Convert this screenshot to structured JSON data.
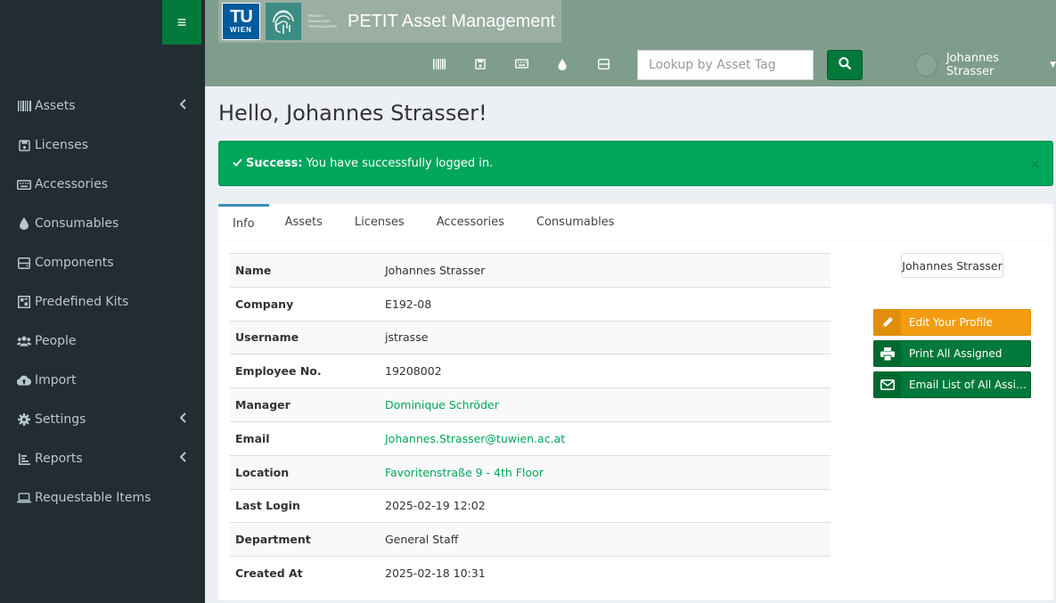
{
  "brand": {
    "tu_top": "TU",
    "tu_bottom": "WIEN",
    "pet_text": "PRIVACY ENHANCING TECHNOLOGIES",
    "title": "PETIT Asset Management"
  },
  "header": {
    "lookup_placeholder": "Lookup by Asset Tag",
    "user_name": "Johannes Strasser"
  },
  "sidebar": {
    "items": [
      {
        "label": "Assets",
        "icon": "barcode-icon"
      },
      {
        "label": "Licenses",
        "icon": "save-icon"
      },
      {
        "label": "Accessories",
        "icon": "keyboard-icon"
      },
      {
        "label": "Consumables",
        "icon": "drop-icon"
      },
      {
        "label": "Components",
        "icon": "harddrive-icon"
      },
      {
        "label": "Predefined Kits",
        "icon": "kit-icon"
      },
      {
        "label": "People",
        "icon": "users-icon"
      },
      {
        "label": "Import",
        "icon": "cloud-upload-icon"
      },
      {
        "label": "Settings",
        "icon": "gear-icon"
      },
      {
        "label": "Reports",
        "icon": "chart-icon"
      },
      {
        "label": "Requestable Items",
        "icon": "laptop-icon"
      }
    ]
  },
  "main": {
    "greeting": "Hello, Johannes Strasser!",
    "alert_strong": "Success:",
    "alert_text": "You have successfully logged in.",
    "alert_close": "×",
    "tabs": [
      "Info",
      "Assets",
      "Licenses",
      "Accessories",
      "Consumables"
    ],
    "info_rows": [
      {
        "label": "Name",
        "value": "Johannes Strasser"
      },
      {
        "label": "Company",
        "value": "E192-08"
      },
      {
        "label": "Username",
        "value": "jstrasse"
      },
      {
        "label": "Employee No.",
        "value": "19208002"
      },
      {
        "label": "Manager",
        "value": "Dominique Schröder"
      },
      {
        "label": "Email",
        "value": "Johannes.Strasser@tuwien.ac.at"
      },
      {
        "label": "Location",
        "value": "Favoritenstraße 9 - 4th Floor"
      },
      {
        "label": "Last Login",
        "value": "2025-02-19 12:02"
      },
      {
        "label": "Department",
        "value": "General Staff"
      },
      {
        "label": "Created At",
        "value": "2025-02-18 10:31"
      }
    ],
    "name_tag": "Johannes Strasser",
    "edit_profile": "Edit Your Profile",
    "print_all": "Print All Assigned",
    "email_list": "Email List of All Assigned"
  },
  "colors": {
    "sidebar_bg": "#222d32",
    "header_bg": "#7f9d8d",
    "brand_green": "#00793b",
    "success": "#00a65a",
    "warning": "#f39c12",
    "link": "#00a65a"
  }
}
